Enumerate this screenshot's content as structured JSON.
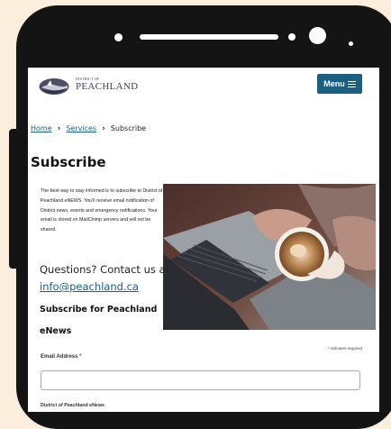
{
  "header": {
    "logo_small": "DISTRICT OF",
    "logo_big": "PEACHLAND",
    "menu_label": "Menu"
  },
  "breadcrumb": {
    "home": "Home",
    "services": "Services",
    "current": "Subscribe",
    "separator": "›"
  },
  "page": {
    "title": "Subscribe",
    "intro": "The best way to stay informed is to subscribe to District of Peachland eNEWS. You'll receive email notification of District news, events and emergency notifications. Your email is stored on MailChimp servers and will not be shared.",
    "contact_question": "Questions? Contact us at",
    "contact_email": "info@peachland.ca",
    "subscribe_heading": "Subscribe for Peachland eNews"
  },
  "form": {
    "required_star": "*",
    "required_note": " indicates required",
    "email_label": "Email Address ",
    "email_star": "*",
    "email_value": "",
    "group_label": "District of Peachland eNews"
  },
  "colors": {
    "accent": "#1b5f82",
    "background": "#fbeedd",
    "phone": "#141414",
    "required": "#d33"
  },
  "icons": {
    "menu": "hamburger-icon",
    "breadcrumb_separator": "chevron-right-icon",
    "logo": "peachland-logo"
  }
}
